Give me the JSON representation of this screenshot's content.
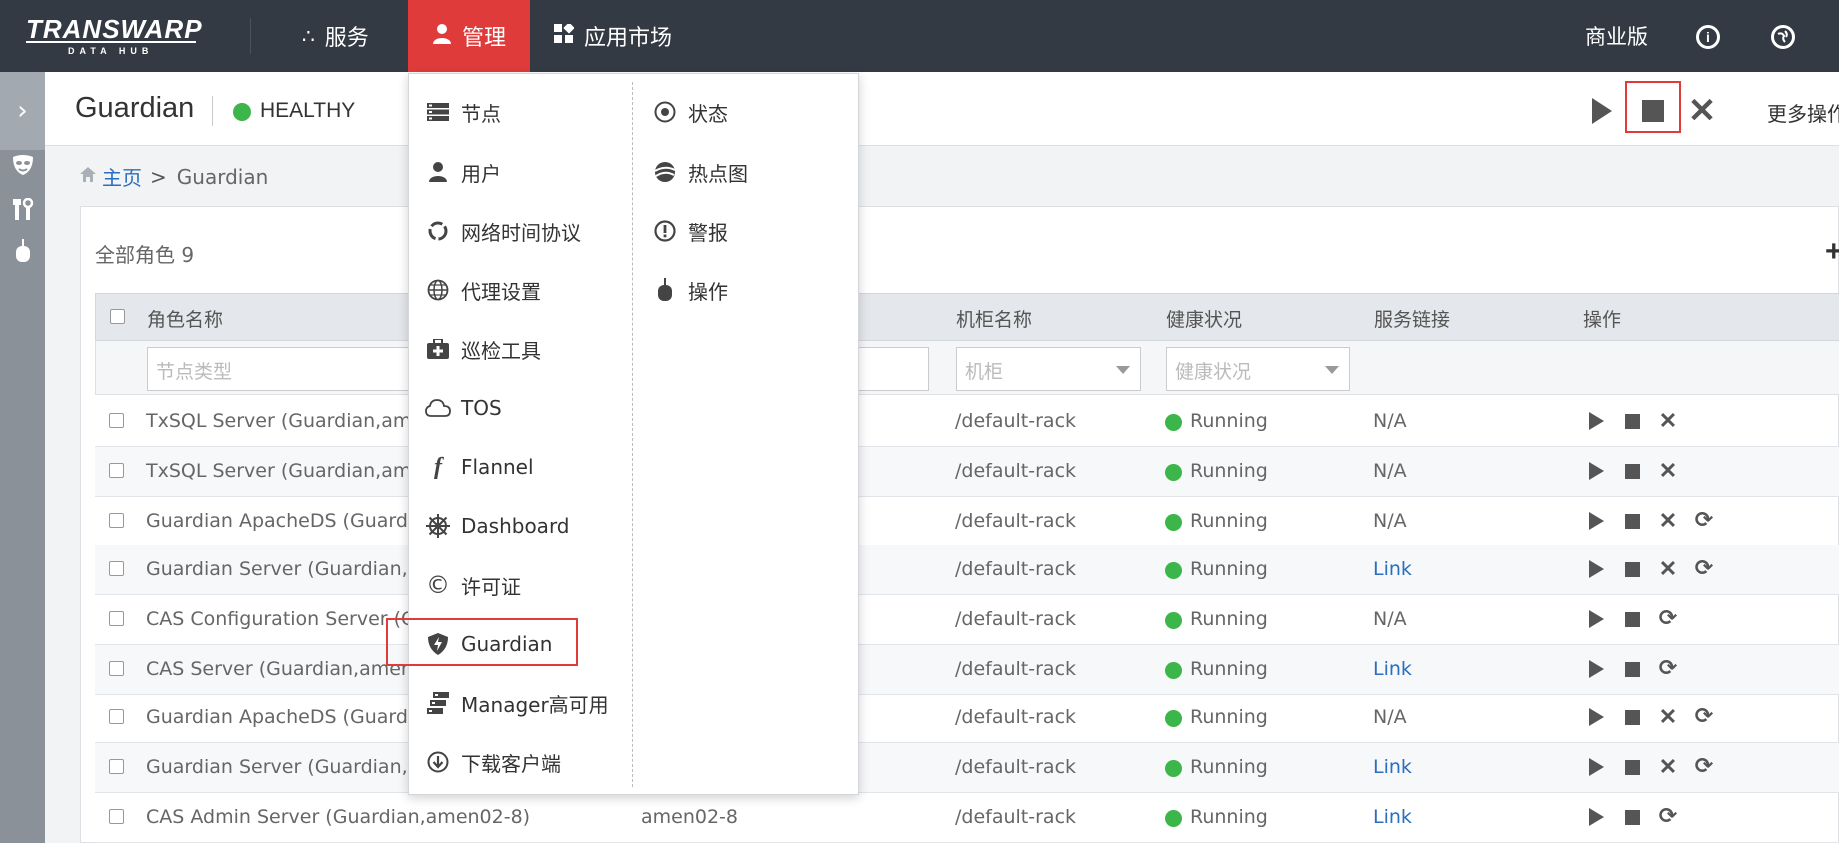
{
  "logo": {
    "main": "TRANSWARP",
    "sub": "DATA HUB"
  },
  "nav": {
    "items": [
      {
        "label": "服务",
        "icon": "services-icon"
      },
      {
        "label": "管理",
        "icon": "user-icon"
      },
      {
        "label": "应用市场",
        "icon": "app-market-icon"
      }
    ],
    "edition": "商业版",
    "info_icon": "info-icon",
    "globe_icon": "globe-icon"
  },
  "header": {
    "service_name": "Guardian",
    "status": "HEALTHY",
    "more_ops": "更多操作"
  },
  "breadcrumb": {
    "home": "主页",
    "separator": ">",
    "current": "Guardian"
  },
  "panel": {
    "roles_count": "全部角色 9",
    "columns": {
      "role_name": "角色名称",
      "rack_name": "机柜名称",
      "health": "健康状况",
      "service_link": "服务链接",
      "actions": "操作"
    },
    "filters": {
      "node_type": "节点类型",
      "host": "",
      "rack": "机柜",
      "health": "健康状况"
    },
    "rows": [
      {
        "role": "TxSQL Server (Guardian,ame",
        "host": "",
        "rack": "/default-rack",
        "status": "Running",
        "link": "N/A",
        "link_active": false,
        "ops": [
          "play",
          "stop",
          "delete"
        ]
      },
      {
        "role": "TxSQL Server (Guardian,ame",
        "host": "",
        "rack": "/default-rack",
        "status": "Running",
        "link": "N/A",
        "link_active": false,
        "ops": [
          "play",
          "stop",
          "delete"
        ]
      },
      {
        "role": "Guardian ApacheDS (Guardi",
        "host": "",
        "rack": "/default-rack",
        "status": "Running",
        "link": "N/A",
        "link_active": false,
        "ops": [
          "play",
          "stop",
          "delete",
          "refresh"
        ]
      },
      {
        "role": "Guardian Server (Guardian,a",
        "host": "",
        "rack": "/default-rack",
        "status": "Running",
        "link": "Link",
        "link_active": true,
        "ops": [
          "play",
          "stop",
          "delete",
          "refresh"
        ]
      },
      {
        "role": "CAS Configuration Server (G",
        "host": "",
        "rack": "/default-rack",
        "status": "Running",
        "link": "N/A",
        "link_active": false,
        "ops": [
          "play",
          "stop",
          "refresh"
        ]
      },
      {
        "role": "CAS Server (Guardian,amen",
        "host": "",
        "rack": "/default-rack",
        "status": "Running",
        "link": "Link",
        "link_active": true,
        "ops": [
          "play",
          "stop",
          "refresh"
        ]
      },
      {
        "role": "Guardian ApacheDS (Guardi",
        "host": "",
        "rack": "/default-rack",
        "status": "Running",
        "link": "N/A",
        "link_active": false,
        "ops": [
          "play",
          "stop",
          "delete",
          "refresh"
        ]
      },
      {
        "role": "Guardian Server (Guardian,a",
        "host": "",
        "rack": "/default-rack",
        "status": "Running",
        "link": "Link",
        "link_active": true,
        "ops": [
          "play",
          "stop",
          "delete",
          "refresh"
        ]
      },
      {
        "role": "CAS Admin Server (Guardian,amen02-8)",
        "host": "amen02-8",
        "rack": "/default-rack",
        "status": "Running",
        "link": "Link",
        "link_active": true,
        "ops": [
          "play",
          "stop",
          "refresh"
        ]
      }
    ]
  },
  "menu": {
    "left": [
      {
        "label": "节点",
        "icon": "nodes-icon"
      },
      {
        "label": "用户",
        "icon": "user-icon"
      },
      {
        "label": "网络时间协议",
        "icon": "ntp-icon"
      },
      {
        "label": "代理设置",
        "icon": "proxy-globe-icon"
      },
      {
        "label": "巡检工具",
        "icon": "toolbox-icon"
      },
      {
        "label": "TOS",
        "icon": "cloud-icon"
      },
      {
        "label": "Flannel",
        "icon": "flannel-icon"
      },
      {
        "label": "Dashboard",
        "icon": "wheel-icon"
      },
      {
        "label": "许可证",
        "icon": "copyright-icon"
      },
      {
        "label": "Guardian",
        "icon": "shield-icon"
      },
      {
        "label": "Manager高可用",
        "icon": "servers-icon"
      },
      {
        "label": "下载客户端",
        "icon": "download-icon"
      }
    ],
    "right": [
      {
        "label": "状态",
        "icon": "status-icon"
      },
      {
        "label": "热点图",
        "icon": "heatmap-icon"
      },
      {
        "label": "警报",
        "icon": "alert-icon"
      },
      {
        "label": "操作",
        "icon": "mouse-icon"
      }
    ]
  },
  "colors": {
    "active_nav": "#e03b3b",
    "topbar": "#333a43",
    "link": "#2a6ebd",
    "healthy": "#3cb54a",
    "highlight_box": "#e03b3b"
  }
}
